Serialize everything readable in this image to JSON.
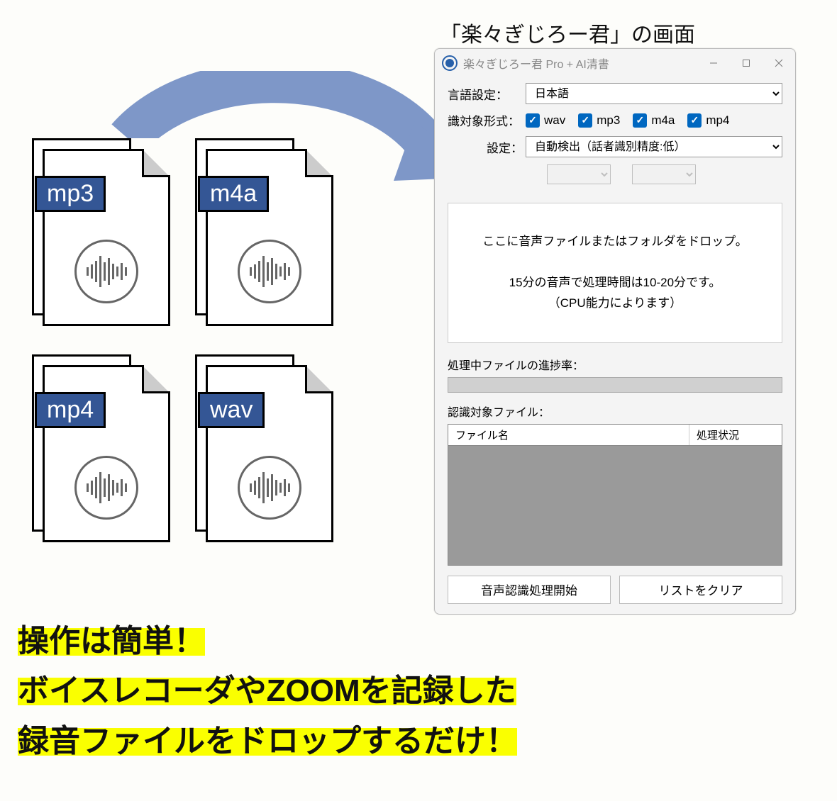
{
  "caption": "「楽々ぎじろー君」の画面",
  "files": [
    "mp3",
    "m4a",
    "mp4",
    "wav"
  ],
  "window": {
    "title": "楽々ぎじろー君 Pro + AI清書",
    "lang_label": "言語設定：",
    "lang_value": "日本語",
    "format_label": "識対象形式：",
    "formats": [
      "wav",
      "mp3",
      "m4a",
      "mp4"
    ],
    "detect_label": "設定：",
    "detect_value": "自動検出（話者識別精度:低）",
    "drop_line1": "ここに音声ファイルまたはフォルダをドロップ。",
    "drop_line2": "15分の音声で処理時間は10-20分です。",
    "drop_line3": "（CPU能力によります）",
    "progress_label": "処理中ファイルの進捗率：",
    "list_label": "認識対象ファイル：",
    "col_filename": "ファイル名",
    "col_status": "処理状況",
    "btn_start": "音声認識処理開始",
    "btn_clear": "リストをクリア"
  },
  "promo": {
    "l1": "操作は簡単！",
    "l2": "ボイスレコーダやZOOMを記録した",
    "l3": "録音ファイルをドロップするだけ！"
  }
}
